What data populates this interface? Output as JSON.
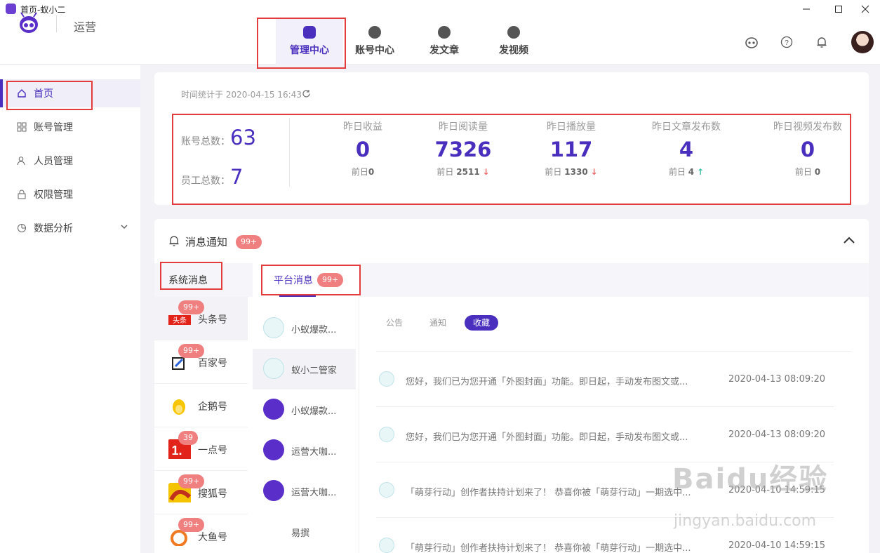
{
  "window": {
    "title": "首页-蚁小二"
  },
  "header": {
    "brand": "运营",
    "nav": [
      {
        "label": "管理中心",
        "icon": "tv-icon"
      },
      {
        "label": "账号中心",
        "icon": "account-icon"
      },
      {
        "label": "发文章",
        "icon": "article-icon"
      },
      {
        "label": "发视频",
        "icon": "video-icon"
      }
    ],
    "right_icons": [
      "robot-icon",
      "help-icon",
      "bell-icon",
      "avatar"
    ]
  },
  "sidebar": {
    "items": [
      {
        "label": "首页",
        "icon": "home-icon"
      },
      {
        "label": "账号管理",
        "icon": "grid-icon"
      },
      {
        "label": "人员管理",
        "icon": "user-icon"
      },
      {
        "label": "权限管理",
        "icon": "lock-icon"
      },
      {
        "label": "数据分析",
        "icon": "pie-icon"
      }
    ]
  },
  "stats": {
    "time_label": "时间统计于 2020-04-15 16:43",
    "account_total_label": "账号总数：",
    "account_total": "63",
    "staff_total_label": "员工总数：",
    "staff_total": "7",
    "metrics": [
      {
        "title": "昨日收益",
        "value": "0",
        "prev_label": "前日",
        "prev": "0",
        "trend": ""
      },
      {
        "title": "昨日阅读量",
        "value": "7326",
        "prev_label": "前日",
        "prev": "2511",
        "trend": "↓"
      },
      {
        "title": "昨日播放量",
        "value": "117",
        "prev_label": "前日",
        "prev": "1330",
        "trend": "↓"
      },
      {
        "title": "昨日文章发布数",
        "value": "4",
        "prev_label": "前日",
        "prev": "4",
        "trend": "↑"
      },
      {
        "title": "昨日视频发布数",
        "value": "0",
        "prev_label": "前日",
        "prev": "0",
        "trend": ""
      }
    ]
  },
  "messages": {
    "title": "消息通知",
    "badge": "99+",
    "tab_system": "系统消息",
    "tab_platform": "平台消息",
    "tab_platform_badge": "99+",
    "sources": [
      {
        "name": "头条号",
        "badge": "99+"
      },
      {
        "name": "百家号",
        "badge": "99+"
      },
      {
        "name": "企鹅号",
        "badge": ""
      },
      {
        "name": "一点号",
        "badge": "39"
      },
      {
        "name": "搜狐号",
        "badge": "99+"
      },
      {
        "name": "大鱼号",
        "badge": "99+"
      }
    ],
    "channels": [
      {
        "name": "小蚁爆款..."
      },
      {
        "name": "蚁小二管家"
      },
      {
        "name": "小蚁爆款..."
      },
      {
        "name": "运营大咖..."
      },
      {
        "name": "运营大咖..."
      },
      {
        "name": "易撰"
      }
    ],
    "filters": [
      "公告",
      "通知",
      "收藏"
    ],
    "rows": [
      {
        "text": "您好，我们已为您开通「外图封面」功能。即日起，手动发布图文或...",
        "time": "2020-04-13 08:09:20"
      },
      {
        "text": "您好，我们已为您开通「外图封面」功能。即日起，手动发布图文或...",
        "time": "2020-04-13 08:09:20"
      },
      {
        "text": "「萌芽行动」创作者扶持计划来了！ 恭喜你被「萌芽行动」一期选中...",
        "time": "2020-04-10 14:59:15"
      },
      {
        "text": "「萌芽行动」创作者扶持计划来了！ 恭喜你被「萌芽行动」一期选中...",
        "time": "2020-04-10 14:59:15"
      }
    ]
  },
  "watermark": {
    "line1": "Baidu经验",
    "line2": "jingyan.baidu.com"
  },
  "colors": {
    "accent": "#4a2fbf",
    "badge": "#f08080",
    "annotation": "#e23c3c"
  }
}
